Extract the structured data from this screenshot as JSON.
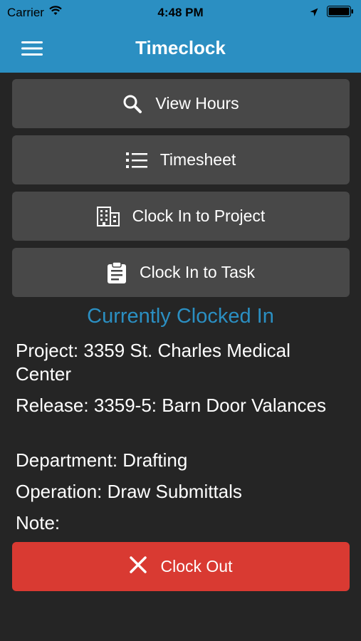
{
  "status_bar": {
    "carrier": "Carrier",
    "time": "4:48 PM",
    "icons": [
      "wifi-icon",
      "location-arrow-icon",
      "battery-icon"
    ]
  },
  "navbar": {
    "title": "Timeclock",
    "menu_icon": "hamburger-menu-icon"
  },
  "actions": [
    {
      "label": "View Hours",
      "icon": "search-icon"
    },
    {
      "label": "Timesheet",
      "icon": "list-icon"
    },
    {
      "label": "Clock In to Project",
      "icon": "building-icon"
    },
    {
      "label": "Clock In to Task",
      "icon": "clipboard-icon"
    }
  ],
  "current": {
    "heading": "Currently Clocked In",
    "project": "Project: 3359 St. Charles Medical Center",
    "release": "Release: 3359-5: Barn Door Valances",
    "department": "Department: Drafting",
    "operation": "Operation: Draw Submittals",
    "note": "Note:"
  },
  "clock_out": {
    "label": "Clock Out",
    "icon": "close-icon"
  },
  "colors": {
    "accent": "#2b8fc2",
    "background": "#252525",
    "button": "#484848",
    "danger": "#d93a32"
  }
}
